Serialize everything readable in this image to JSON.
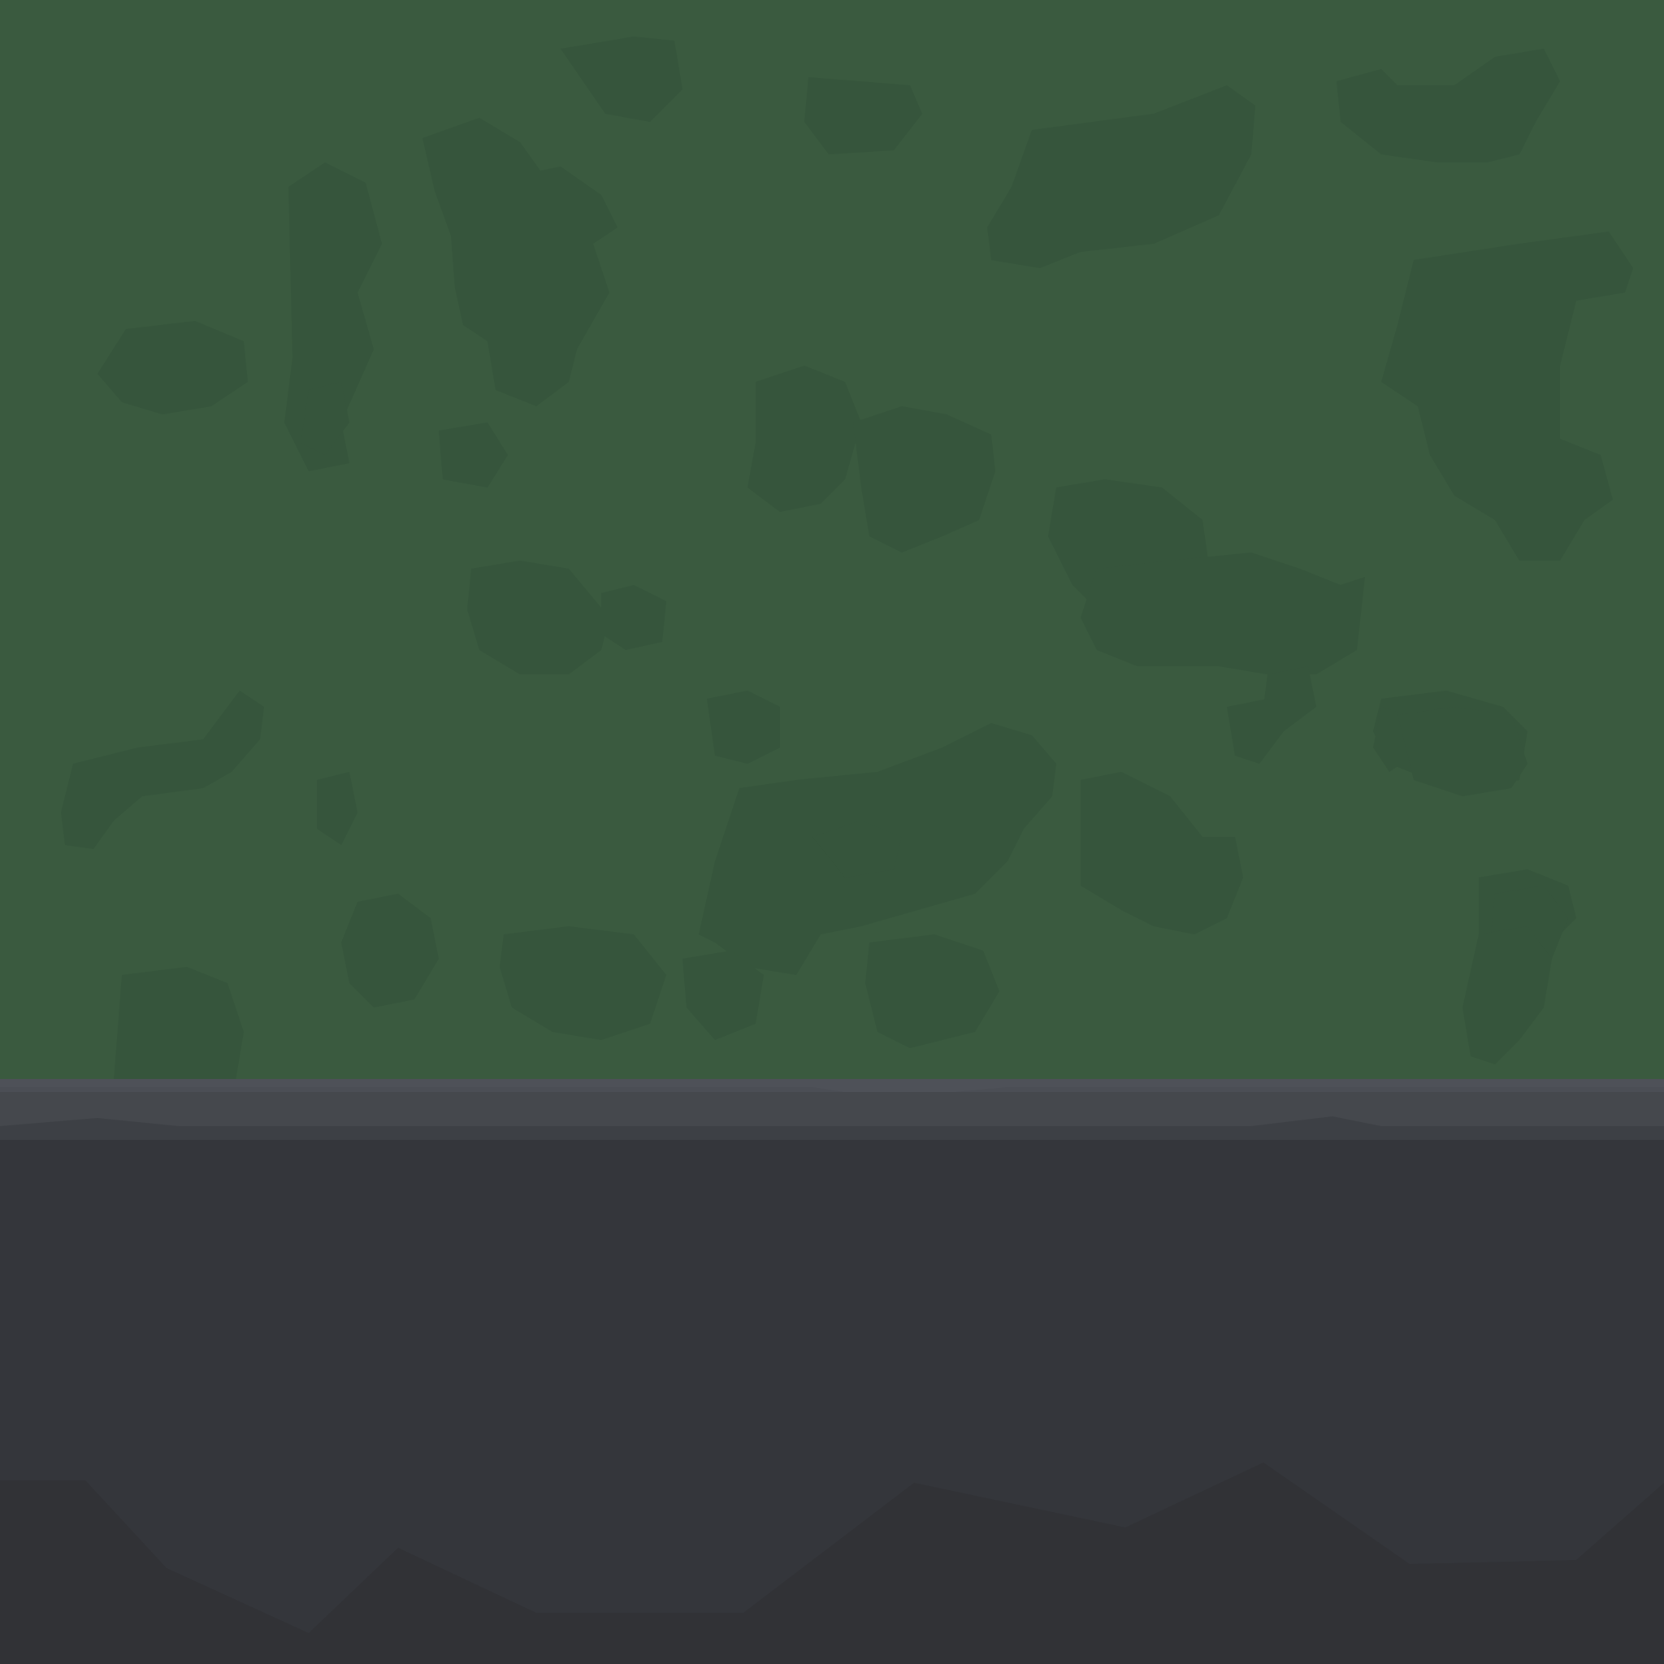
{
  "scene": {
    "type": "tileset-texture",
    "regions": [
      "grass",
      "stone-ledge",
      "rock-base"
    ],
    "colors": {
      "grass_base": "#3a5a3f",
      "grass_patch": "#36553c",
      "ledge_top": "#4e5158",
      "ledge_mid": "#45484d",
      "ledge_lip": "#3d4045",
      "rock_upper": "#34363b",
      "rock_lower": "#313236"
    }
  }
}
